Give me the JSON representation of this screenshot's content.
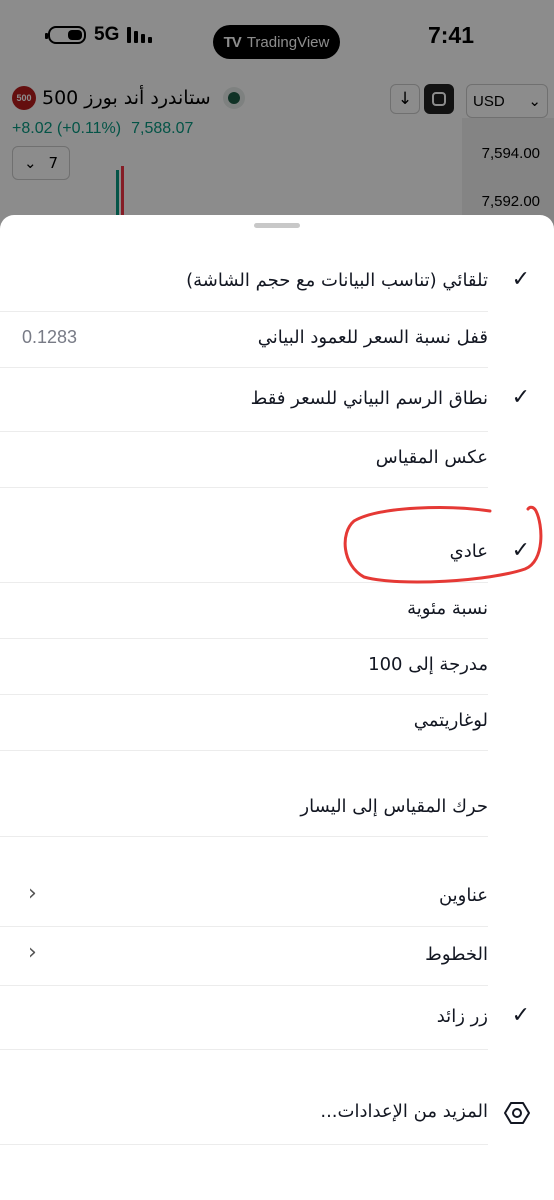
{
  "status_bar": {
    "network": "5G",
    "brand": "TradingView",
    "time": "7:41"
  },
  "chart": {
    "symbol_badge": "500",
    "symbol_name": "ستاندرد أند بورز 500",
    "change": "+8.02 (+0.11%)",
    "last_price": "7,588.07",
    "interval": "7",
    "currency": "USD",
    "price_labels": [
      "7,594.00",
      "7,592.00"
    ],
    "change_color": "#089981"
  },
  "menu": {
    "items": [
      {
        "label": "تلقائي (تناسب البيانات مع حجم الشاشة)",
        "checked": true
      },
      {
        "label": "قفل نسبة السعر للعمود البياني",
        "value": "0.1283"
      },
      {
        "label": "نطاق الرسم البياني للسعر فقط",
        "checked": true
      },
      {
        "label": "عكس المقياس"
      },
      {
        "label": "عادي",
        "checked": true
      },
      {
        "label": "نسبة مئوية"
      },
      {
        "label": "مدرجة إلى 100"
      },
      {
        "label": "لوغاريتمي"
      },
      {
        "label": "حرك المقياس إلى اليسار"
      },
      {
        "label": "عناوين",
        "submenu": true
      },
      {
        "label": "الخطوط",
        "submenu": true
      },
      {
        "label": "زر زائد",
        "checked": true
      },
      {
        "label": "المزيد من الإعدادات...",
        "icon": "settings-hexagon-icon"
      }
    ],
    "check_glyph": "✓",
    "chevron_glyph": "‹",
    "highlight_color": "#e53935"
  }
}
